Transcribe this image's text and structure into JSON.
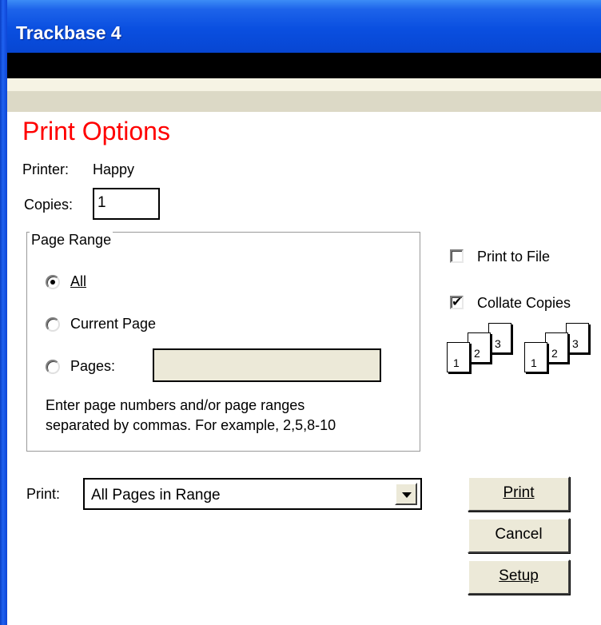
{
  "window": {
    "title": "Trackbase 4"
  },
  "heading": "Print Options",
  "printer": {
    "label": "Printer:",
    "value": "Happy"
  },
  "copies": {
    "label": "Copies:",
    "value": "1"
  },
  "page_range": {
    "legend": "Page Range",
    "options": [
      {
        "label": "All",
        "selected": true
      },
      {
        "label": "Current Page",
        "selected": false
      },
      {
        "label": "Pages:",
        "selected": false
      }
    ],
    "pages_value": "",
    "hint_line1": "Enter page numbers and/or page ranges",
    "hint_line2": "separated by commas. For example, 2,5,8-10"
  },
  "print_to_file": {
    "label": "Print to File",
    "checked": false
  },
  "collate_copies": {
    "label": "Collate Copies",
    "checked": true
  },
  "collate_icon_pages": [
    "1",
    "2",
    "3"
  ],
  "print_select": {
    "label": "Print:",
    "value": "All Pages in Range"
  },
  "buttons": {
    "print": "Print",
    "cancel": "Cancel",
    "setup": "Setup"
  },
  "colors": {
    "heading": "#ff0000",
    "titlebar": "#0a4fe0",
    "face": "#ece9d8"
  }
}
